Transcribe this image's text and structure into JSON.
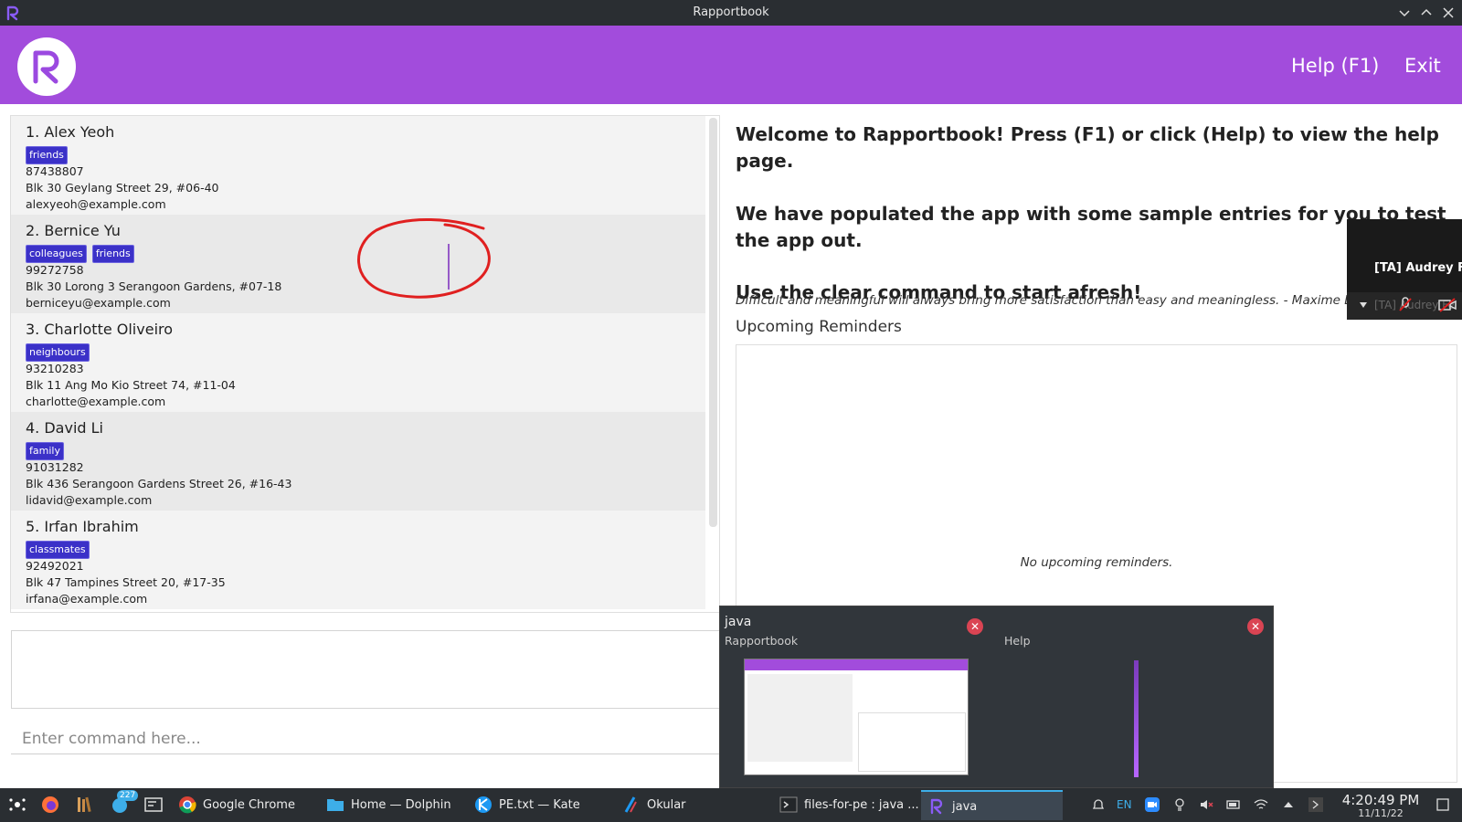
{
  "window": {
    "title": "Rapportbook"
  },
  "header": {
    "help_label": "Help (F1)",
    "exit_label": "Exit"
  },
  "persons": [
    {
      "index": "1.",
      "name": "Alex Yeoh",
      "tags": [
        "friends"
      ],
      "phone": "87438807",
      "address": "Blk 30 Geylang Street 29, #06-40",
      "email": "alexyeoh@example.com"
    },
    {
      "index": "2.",
      "name": "Bernice Yu",
      "tags": [
        "colleagues",
        "friends"
      ],
      "phone": "99272758",
      "address": "Blk 30 Lorong 3 Serangoon Gardens, #07-18",
      "email": "berniceyu@example.com"
    },
    {
      "index": "3.",
      "name": "Charlotte Oliveiro",
      "tags": [
        "neighbours"
      ],
      "phone": "93210283",
      "address": "Blk 11 Ang Mo Kio Street 74, #11-04",
      "email": "charlotte@example.com"
    },
    {
      "index": "4.",
      "name": "David Li",
      "tags": [
        "family"
      ],
      "phone": "91031282",
      "address": "Blk 436 Serangoon Gardens Street 26, #16-43",
      "email": "lidavid@example.com"
    },
    {
      "index": "5.",
      "name": "Irfan Ibrahim",
      "tags": [
        "classmates"
      ],
      "phone": "92492021",
      "address": "Blk 47 Tampines Street 20, #17-35",
      "email": "irfana@example.com"
    }
  ],
  "command": {
    "placeholder": "Enter command here..."
  },
  "welcome": {
    "line1": "Welcome to Rapportbook! Press (F1) or click (Help) to view the help page.",
    "line2": "We have populated the app with some sample entries for you to test the app out.",
    "line3": "Use the clear command to start afresh!",
    "quote": "Difficult and meaningful will always bring more satisfaction than easy and meaningless. - Maxime Lagacé"
  },
  "reminders": {
    "title": "Upcoming Reminders",
    "empty_text": "No upcoming reminders."
  },
  "zoom_overlay": {
    "name": "[TA] Audrey Fe",
    "faint_name": "[TA] Audrey Fe"
  },
  "task_switcher": {
    "item1_title": "java",
    "item1_sub": "Rapportbook",
    "item2_sub": "Help"
  },
  "taskbar": {
    "badge": "227",
    "tasks": [
      {
        "label": "Google Chrome"
      },
      {
        "label": "Home — Dolphin"
      },
      {
        "label": "PE.txt — Kate"
      },
      {
        "label": "Okular"
      },
      {
        "label": "files-for-pe : java ..."
      },
      {
        "label": "java"
      }
    ],
    "lang": "EN",
    "time": "4:20:49 PM",
    "date": "11/11/22"
  },
  "colors": {
    "header": "#a24cdc",
    "tag": "#3b31c8",
    "taskbar": "#2a2e32",
    "annotation": "#e02020"
  }
}
